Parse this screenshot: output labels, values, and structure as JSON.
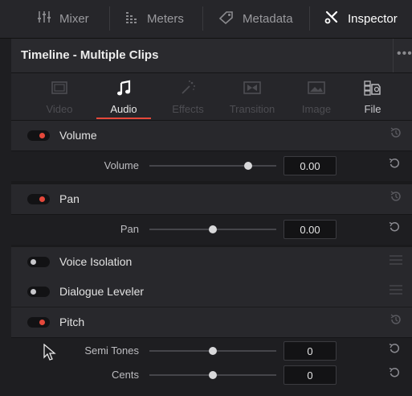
{
  "toolbar": {
    "tabs": [
      {
        "label": "Mixer",
        "icon": "mixer-icon"
      },
      {
        "label": "Meters",
        "icon": "meters-icon"
      },
      {
        "label": "Metadata",
        "icon": "metadata-icon"
      },
      {
        "label": "Inspector",
        "icon": "inspector-icon",
        "active": true
      }
    ]
  },
  "panel": {
    "title": "Timeline - Multiple Clips",
    "more": "•••"
  },
  "inspector_tabs": [
    {
      "label": "Video",
      "icon": "video-icon"
    },
    {
      "label": "Audio",
      "icon": "audio-icon",
      "active": true
    },
    {
      "label": "Effects",
      "icon": "effects-icon"
    },
    {
      "label": "Transition",
      "icon": "transition-icon"
    },
    {
      "label": "Image",
      "icon": "image-icon"
    },
    {
      "label": "File",
      "icon": "file-icon"
    }
  ],
  "sections": {
    "volume": {
      "label": "Volume",
      "enabled": true,
      "param_label": "Volume",
      "value": "0.00",
      "slider_fraction": 0.78
    },
    "pan": {
      "label": "Pan",
      "enabled": true,
      "param_label": "Pan",
      "value": "0.00",
      "slider_fraction": 0.5
    },
    "voice_isolation": {
      "label": "Voice Isolation",
      "enabled": false
    },
    "dialogue_leveler": {
      "label": "Dialogue Leveler",
      "enabled": false
    },
    "pitch": {
      "label": "Pitch",
      "enabled": true,
      "semi_tones": {
        "label": "Semi Tones",
        "value": "0",
        "slider_fraction": 0.5
      },
      "cents": {
        "label": "Cents",
        "value": "0",
        "slider_fraction": 0.5
      }
    }
  },
  "colors": {
    "accent": "#e5483b",
    "background": "#1e1e21"
  }
}
